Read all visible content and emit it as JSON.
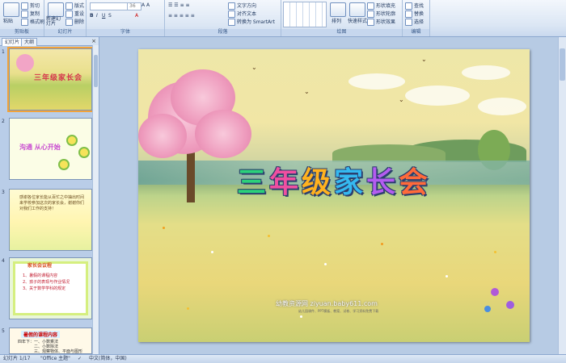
{
  "ribbon": {
    "clipboard": {
      "paste": "粘贴",
      "cut": "剪切",
      "copy": "复制",
      "format_painter": "格式刷",
      "label": "剪贴板"
    },
    "slides": {
      "new_slide": "新建幻灯片",
      "layout": "版式",
      "reset": "重设",
      "delete": "删除",
      "label": "幻灯片"
    },
    "font": {
      "size": "36",
      "label": "字体"
    },
    "paragraph": {
      "text_direction": "文字方向",
      "align_text": "对齐文本",
      "smartart": "转换为 SmartArt",
      "label": "段落"
    },
    "drawing": {
      "arrange": "排列",
      "quick_styles": "快速样式",
      "shape_fill": "形状填充",
      "shape_outline": "形状轮廓",
      "shape_effects": "形状效果",
      "label": "绘图"
    },
    "editing": {
      "find": "查找",
      "replace": "替换",
      "select": "选择",
      "label": "编辑"
    }
  },
  "panel": {
    "tab_slides": "幻灯片",
    "tab_outline": "大纲",
    "close": "×",
    "thumbs": [
      {
        "num": "1",
        "title": "三年级家长会"
      },
      {
        "num": "2",
        "title": "沟通  从心开始"
      },
      {
        "num": "3",
        "text": "感谢各位家长能从百忙之中抽出时间来学校参加这次的家长会，谢谢你们对我们工作的支持！"
      },
      {
        "num": "4",
        "heading": "家长会议程",
        "items": [
          "1、暑假的课程内容",
          "2、孩子的表现与作业情况",
          "3、关于数学学科的规定"
        ]
      },
      {
        "num": "5",
        "heading": "暑假的课程内容",
        "items": [
          "四年下：一、小数乘法",
          "二、小数除法",
          "三、观察物体、平面与图形",
          "四、简易方程"
        ]
      }
    ]
  },
  "slide": {
    "title_chars": [
      "三",
      "年",
      "级",
      "家",
      "长",
      "会"
    ],
    "watermark": "幼教资源网 ziyuan.baby611.com",
    "watermark_sub": "幼儿园课件、PPT模板、教案、试卷、学习资料免费下载"
  },
  "status": {
    "slide_info": "幻灯片 1/17",
    "theme": "\"Office 主题\"",
    "language": "中文(简体，中国)"
  }
}
